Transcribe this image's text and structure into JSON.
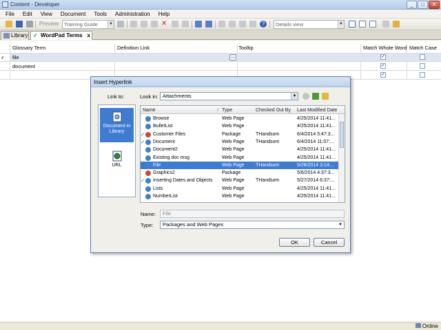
{
  "window": {
    "title": "Content - Developer",
    "controls": {
      "minimize": "_",
      "maximize": "□",
      "close": "✕"
    }
  },
  "menu": [
    "File",
    "Edit",
    "View",
    "Document",
    "Tools",
    "Administration",
    "Help"
  ],
  "toolbar": {
    "preview_label": "Preview",
    "training_combo": "Training Guide",
    "view_combo": "Details view"
  },
  "doc_tabs": [
    {
      "label": "Library",
      "icon": "library-icon"
    },
    {
      "label": "WordPad Terms",
      "icon": "checked-doc-icon",
      "close": "x"
    }
  ],
  "grid": {
    "columns": [
      "Glossary Term",
      "Definition Link",
      "Tooltip",
      "Match Whole Word",
      "Match Case"
    ],
    "row_marker": "⸙",
    "rows": [
      {
        "term": "file",
        "link_button": "...",
        "match_whole": true,
        "match_case": false
      },
      {
        "term": "document",
        "match_whole": true,
        "match_case": false
      },
      {
        "term": "",
        "match_whole": true,
        "match_case": false
      }
    ]
  },
  "status": {
    "online": "Online"
  },
  "dialog": {
    "title": "Insert Hyperlink",
    "link_to_label": "Link to:",
    "link_to_items": [
      "Document in Library",
      "URL"
    ],
    "look_in_label": "Look in:",
    "look_in_value": "Attachments",
    "columns": [
      "Name",
      "Type",
      "Checked Out By",
      "Last Modified Date"
    ],
    "files": [
      {
        "check": "",
        "name": "Browse",
        "type": "Web Page",
        "by": "",
        "date": "4/25/2014 11:41..."
      },
      {
        "check": "",
        "name": "BulletList",
        "type": "Web Page",
        "by": "",
        "date": "4/25/2014 11:41..."
      },
      {
        "check": "✓",
        "name": "Customer Files",
        "type": "Package",
        "by": "THandsom",
        "date": "6/4/2014 5:47:3..."
      },
      {
        "check": "✓",
        "name": "Document",
        "type": "Web Page",
        "by": "THandsom",
        "date": "6/4/2014 11:07:..."
      },
      {
        "check": "",
        "name": "Document2",
        "type": "Web Page",
        "by": "",
        "date": "4/25/2014 11:41..."
      },
      {
        "check": "",
        "name": "Existing doc msg",
        "type": "Web Page",
        "by": "",
        "date": "4/25/2014 11:41..."
      },
      {
        "check": "✓",
        "name": "File",
        "type": "Web Page",
        "by": "THandsom",
        "date": "5/28/2014 3:14:...",
        "selected": true
      },
      {
        "check": "",
        "name": "Graphics2",
        "type": "Package",
        "by": "",
        "date": "5/6/2014 4:37:3..."
      },
      {
        "check": "✓",
        "name": "Inserting Dates and Objects",
        "type": "Web Page",
        "by": "THandsom",
        "date": "5/27/2014 6:37:..."
      },
      {
        "check": "",
        "name": "Lists",
        "type": "Web Page",
        "by": "",
        "date": "4/25/2014 11:41..."
      },
      {
        "check": "",
        "name": "NumberList",
        "type": "Web Page",
        "by": "",
        "date": "4/25/2014 11:41..."
      }
    ],
    "name_label": "Name:",
    "name_value": "File",
    "type_label": "Type:",
    "type_value": "Packages and Web Pages",
    "ok": "OK",
    "cancel": "Cancel"
  }
}
